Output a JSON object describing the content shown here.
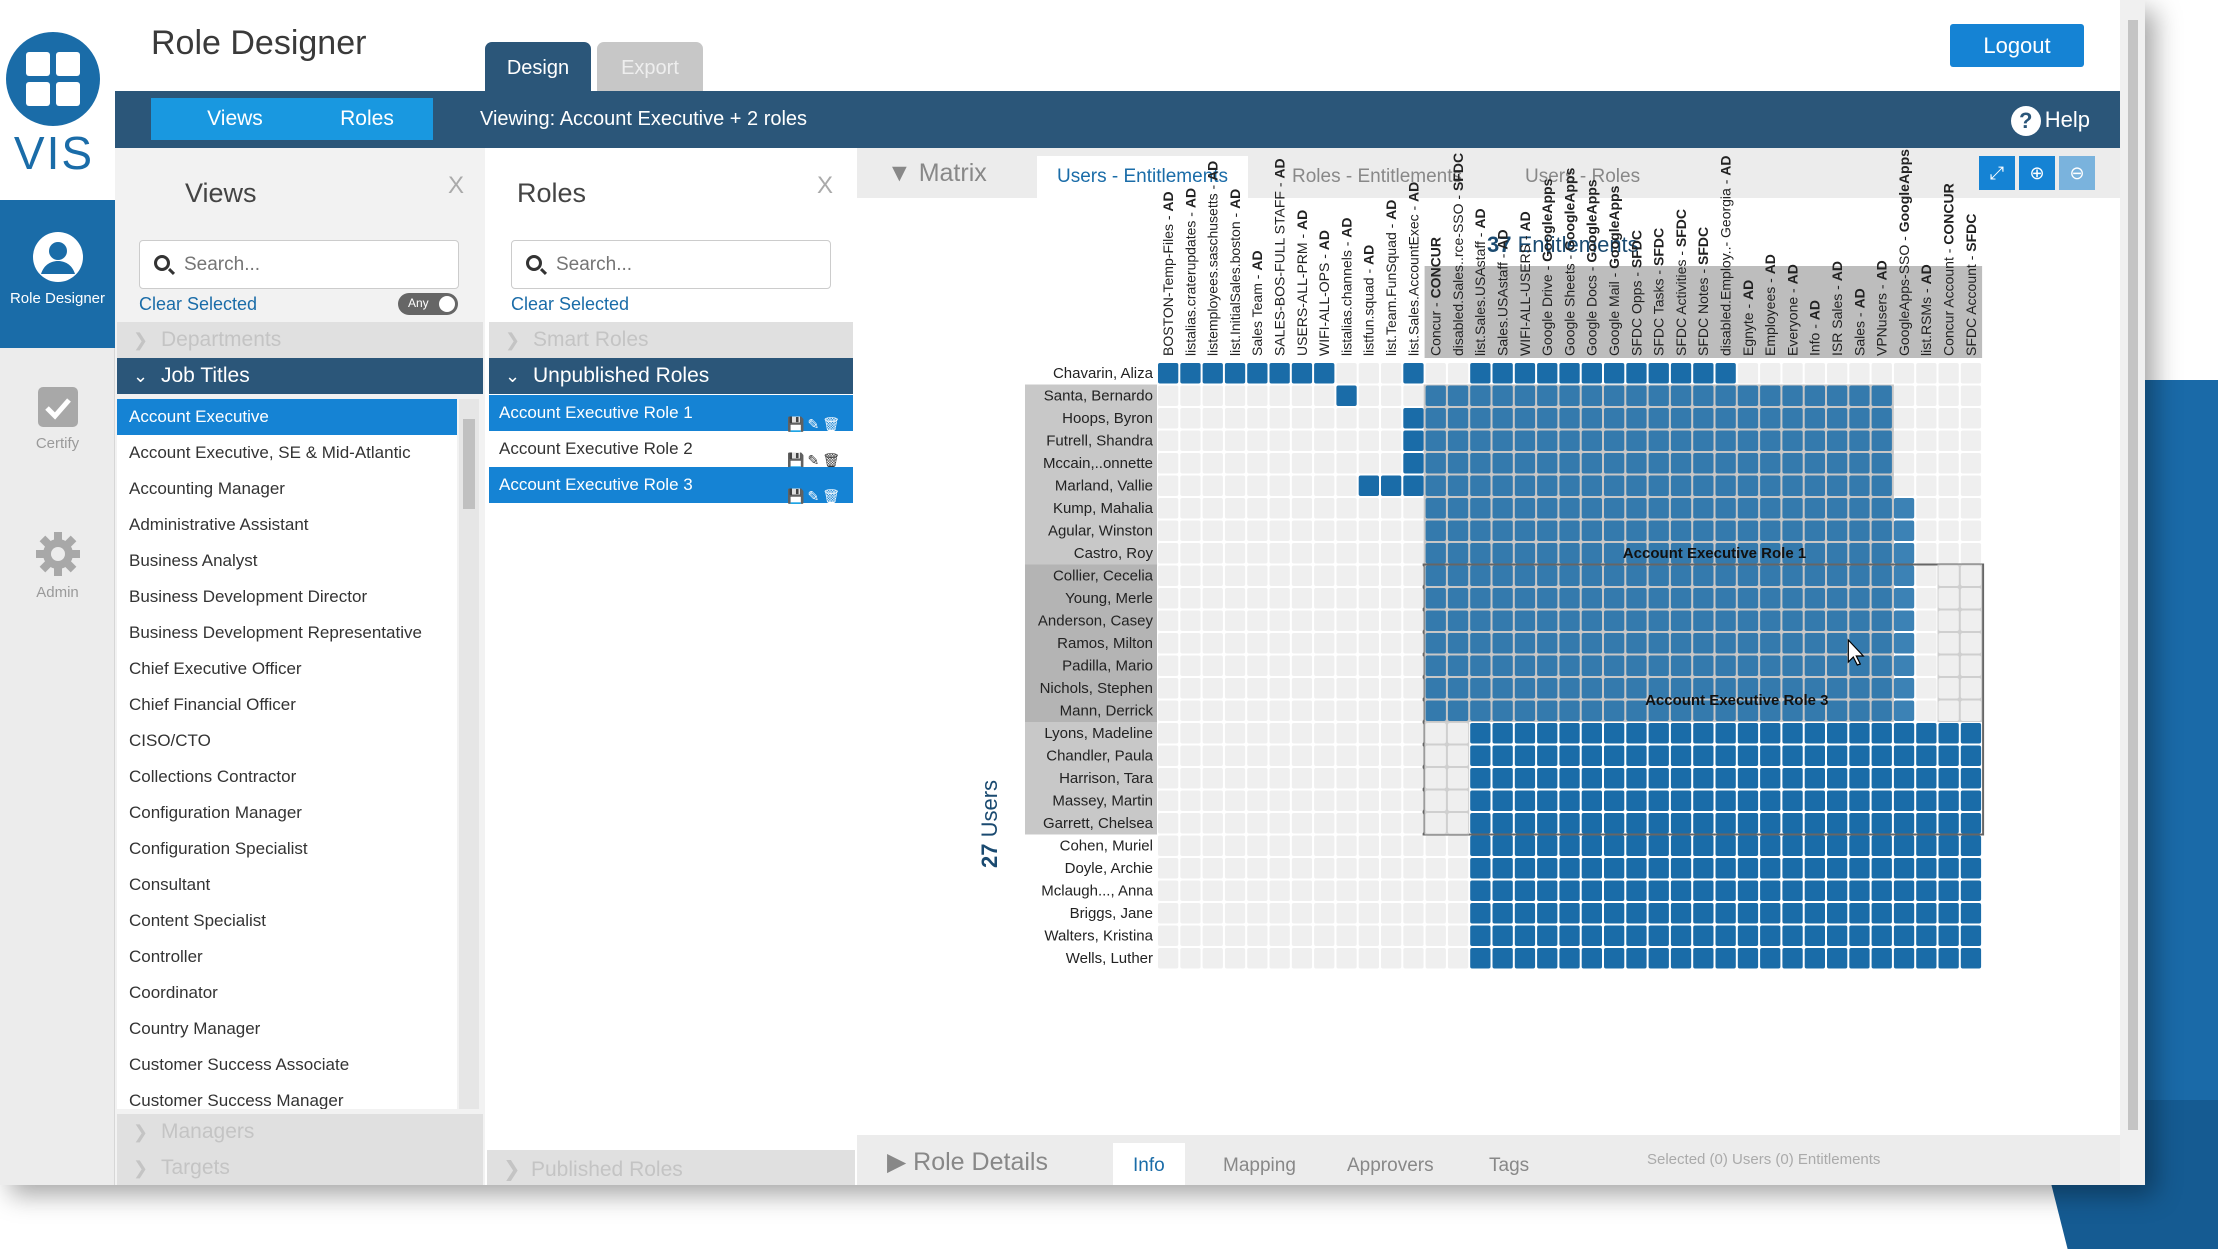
{
  "app": {
    "logo_text": "VIS",
    "title": "Role Designer"
  },
  "nav": [
    {
      "label": "Role Designer"
    },
    {
      "label": "Certify"
    },
    {
      "label": "Admin"
    }
  ],
  "top_tabs": {
    "design": "Design",
    "export": "Export"
  },
  "logout": "Logout",
  "bar": {
    "views": "Views",
    "roles": "Roles",
    "viewing": "Viewing: Account Executive + 2 roles",
    "help": "Help"
  },
  "views_panel": {
    "title": "Views",
    "close": "X",
    "search_placeholder": "Search...",
    "clear_selected": "Clear Selected",
    "toggle": "Any",
    "sections": {
      "departments": "Departments",
      "job_titles": "Job Titles",
      "managers": "Managers",
      "targets": "Targets"
    },
    "job_titles": [
      "Account Executive",
      "Account Executive, SE & Mid-Atlantic",
      "Accounting Manager",
      "Administrative Assistant",
      "Business Analyst",
      "Business Development Director",
      "Business Development Representative",
      "Chief Executive Officer",
      "Chief Financial Officer",
      "CISO/CTO",
      "Collections Contractor",
      "Configuration Manager",
      "Configuration Specialist",
      "Consultant",
      "Content Specialist",
      "Controller",
      "Coordinator",
      "Country Manager",
      "Customer Success Associate",
      "Customer Success Manager"
    ]
  },
  "roles_panel": {
    "title": "Roles",
    "close": "X",
    "search_placeholder": "Search...",
    "clear_selected": "Clear Selected",
    "sections": {
      "smart": "Smart Roles",
      "unpublished": "Unpublished Roles",
      "published": "Published Roles"
    },
    "roles": [
      "Account Executive Role 1",
      "Account Executive Role 2",
      "Account Executive Role 3"
    ]
  },
  "matrix": {
    "title": "Matrix",
    "tabs": [
      "Users - Entitlements",
      "Roles - Entitlements",
      "Users - Roles"
    ],
    "ent_count": "37",
    "ent_label": "Entitlements",
    "user_count": "27",
    "user_label": "Users",
    "entitlements": [
      [
        "BOSTON-Temp-Files - ",
        "AD"
      ],
      [
        "listalias.craterupdates - ",
        "AD"
      ],
      [
        "listemployees.saschusetts - ",
        "AD"
      ],
      [
        "list.InitialSales.boston - ",
        "AD"
      ],
      [
        "Sales Team - ",
        "AD"
      ],
      [
        "SALES-BOS-FULL STAFF - ",
        "AD"
      ],
      [
        "USERS-ALL-PRM - ",
        "AD"
      ],
      [
        "WIFI-ALL-OPS - ",
        "AD"
      ],
      [
        "listalias.channels - ",
        "AD"
      ],
      [
        "listfun.squad - ",
        "AD"
      ],
      [
        "list.Team.FunSquad - ",
        "AD"
      ],
      [
        "list.Sales.AccountExec - ",
        "AD"
      ],
      [
        "Concur - ",
        "CONCUR"
      ],
      [
        "disabled.Sales..rce-SSO - ",
        "SFDC"
      ],
      [
        "list.Sales.USAstaff - ",
        "AD"
      ],
      [
        "Sales.USAstaff - ",
        "AD"
      ],
      [
        "WIFI-ALL-USERS - ",
        "AD"
      ],
      [
        "Google Drive - ",
        "GoogleApps"
      ],
      [
        "Google Sheets - ",
        "GoogleApps"
      ],
      [
        "Google Docs - ",
        "GoogleApps"
      ],
      [
        "Google Mail - ",
        "GoogleApps"
      ],
      [
        "SFDC Opps - ",
        "SFDC"
      ],
      [
        "SFDC Tasks - ",
        "SFDC"
      ],
      [
        "SFDC Activities - ",
        "SFDC"
      ],
      [
        "SFDC Notes - ",
        "SFDC"
      ],
      [
        "disabled.Employ..- Georgia - ",
        "AD"
      ],
      [
        "Egnyte - ",
        "AD"
      ],
      [
        "Employees - ",
        "AD"
      ],
      [
        "Everyone - ",
        "AD"
      ],
      [
        "Info - ",
        "AD"
      ],
      [
        "ISR Sales - ",
        "AD"
      ],
      [
        "Sales - ",
        "AD"
      ],
      [
        "VPNusers - ",
        "AD"
      ],
      [
        "GoogleApps-SSO - ",
        "GoogleApps"
      ],
      [
        "list.RSMs - ",
        "AD"
      ],
      [
        "Concur Account - ",
        "CONCUR"
      ],
      [
        "SFDC Account - ",
        "SFDC"
      ]
    ],
    "users": [
      "Chavarin, Aliza",
      "Santa, Bernardo",
      "Hoops, Byron",
      "Futrell, Shandra",
      "Mccain,..onnette",
      "Marland, Vallie",
      "Kump, Mahalia",
      "Agular, Winston",
      "Castro, Roy",
      "Collier, Cecelia",
      "Young, Merle",
      "Anderson, Casey",
      "Ramos, Milton",
      "Padilla, Mario",
      "Nichols, Stephen",
      "Mann, Derrick",
      "Lyons, Madeline",
      "Chandler, Paula",
      "Harrison, Tara",
      "Massey, Martin",
      "Garrett, Chelsea",
      "Cohen, Muriel",
      "Doyle, Archie",
      "Mclaugh..., Anna",
      "Briggs, Jane",
      "Walters, Kristina",
      "Wells, Luther"
    ],
    "role_labels": [
      "Account Executive Role 1",
      "Account Executive Role 3"
    ]
  },
  "role_details": {
    "title": "Role Details",
    "tabs": [
      "Info",
      "Mapping",
      "Approvers",
      "Tags"
    ],
    "selected": "Selected (0) Users (0) Entitlements"
  },
  "colors": {
    "accent": "#1583d4",
    "navy": "#2b5679",
    "cell_on": "#1a6ca8"
  }
}
